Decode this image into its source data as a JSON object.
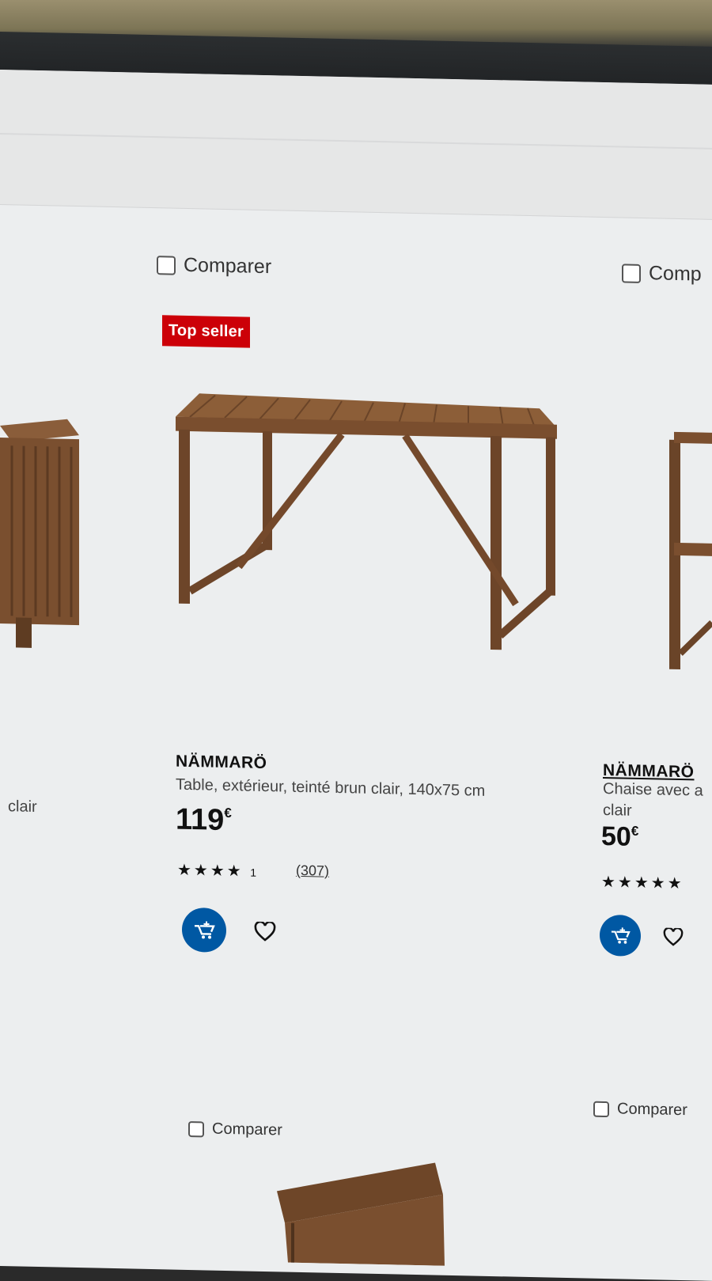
{
  "compare_label": "Comparer",
  "compare_partial": "Comp",
  "products": [
    {
      "badge": "Top seller",
      "name": "NÄMMARÖ",
      "description": "Table, extérieur, teinté brun clair, 140x75 cm",
      "price": "119",
      "currency": "€",
      "rating_stars": "★★★★",
      "rating_extra": "1",
      "reviews": "(307)"
    },
    {
      "name": "NÄMMARÖ",
      "description_line1": "Chaise avec a",
      "description_line2": "clair",
      "price": "50",
      "currency": "€",
      "rating_stars": "★★★★★"
    }
  ],
  "left_partial_label": "clair",
  "colors": {
    "accent": "#0058a3",
    "badge": "#cc0008"
  },
  "icons": [
    "add-to-cart-icon",
    "heart-icon",
    "checkbox-icon"
  ]
}
